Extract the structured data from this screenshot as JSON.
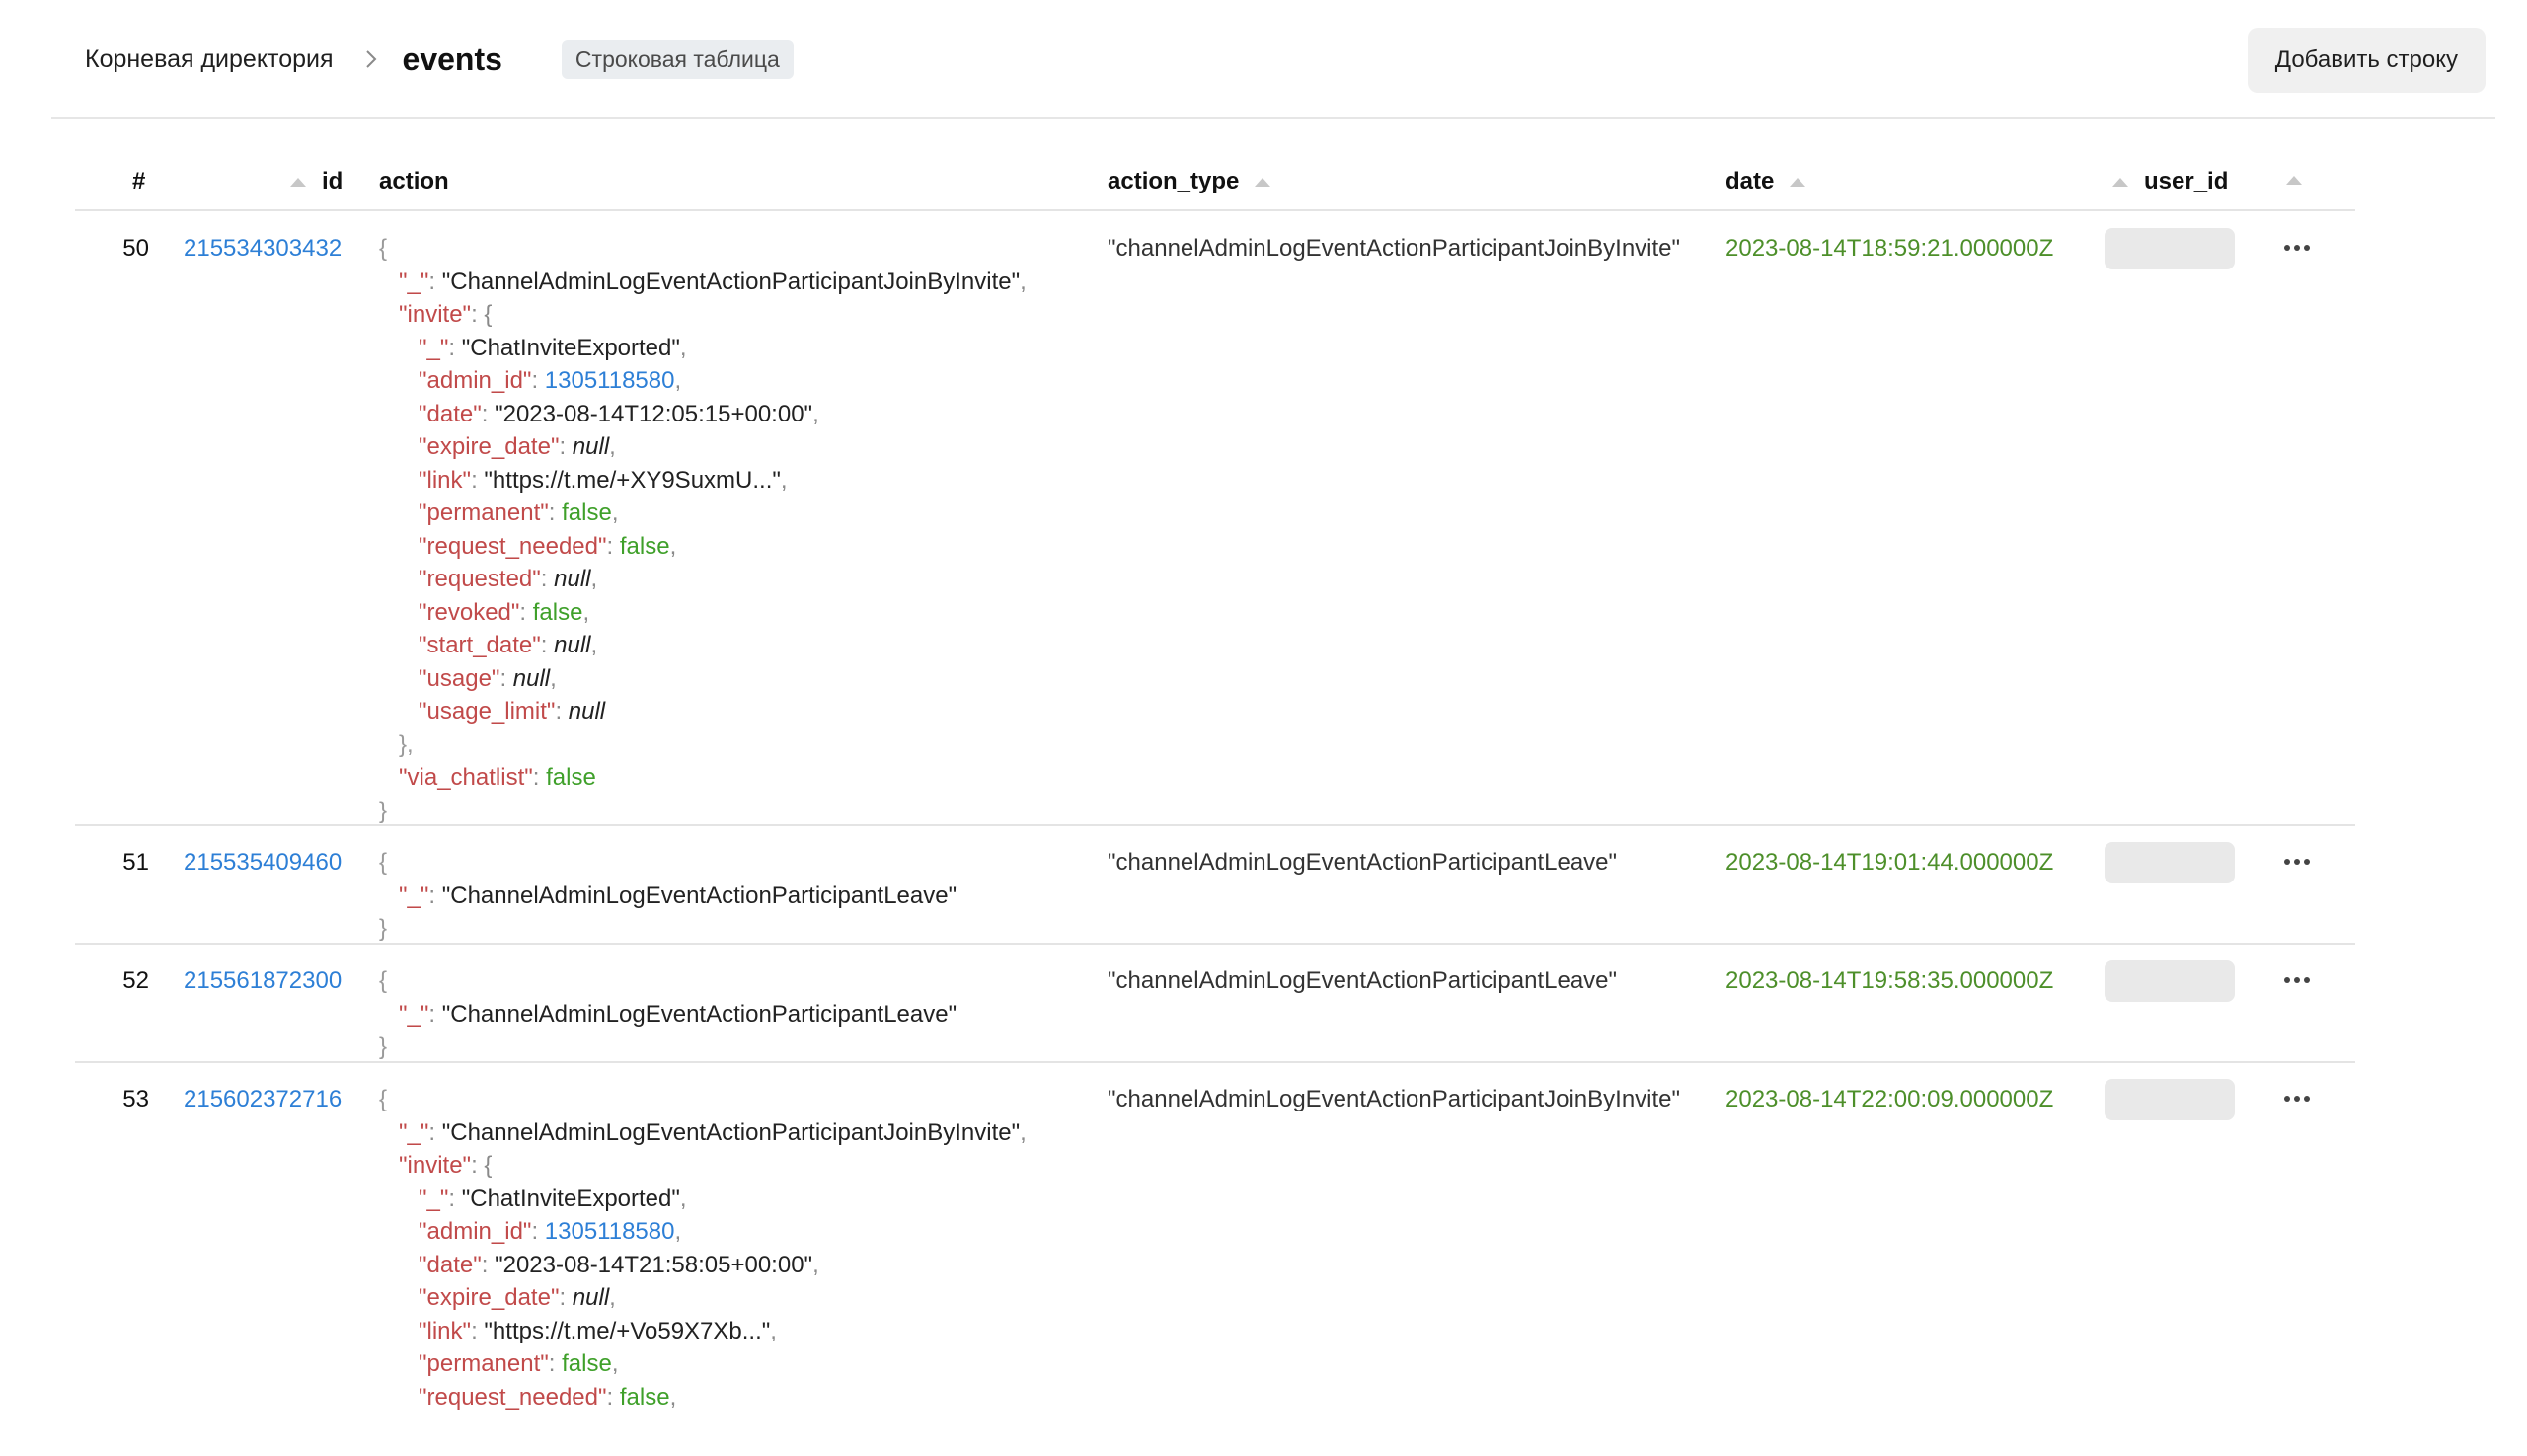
{
  "header": {
    "breadcrumb_root": "Корневая директория",
    "title": "events",
    "table_type": "Строковая таблица",
    "add_row_label": "Добавить строку"
  },
  "columns": [
    "#",
    "id",
    "action",
    "action_type",
    "date",
    "user_id"
  ],
  "colors": {
    "link": "#2d7fd6",
    "json_key": "#c14a4a",
    "bool_value": "#3fa02a",
    "date_value": "#4d8f2a",
    "badge_bg": "#eaedf0"
  },
  "rows": [
    {
      "num": "50",
      "id": "215534303432",
      "action_type": "\"channelAdminLogEventActionParticipantJoinByInvite\"",
      "date": "2023-08-14T18:59:21.000000Z",
      "action": [
        {
          "indent": 0,
          "tokens": [
            {
              "t": "{",
              "c": "brace"
            }
          ]
        },
        {
          "indent": 1,
          "tokens": [
            {
              "t": "\"_\"",
              "c": "key"
            },
            {
              "t": ": ",
              "c": "punc"
            },
            {
              "t": "\"ChannelAdminLogEventActionParticipantJoinByInvite\"",
              "c": "str"
            },
            {
              "t": ",",
              "c": "punc"
            }
          ]
        },
        {
          "indent": 1,
          "tokens": [
            {
              "t": "\"invite\"",
              "c": "key"
            },
            {
              "t": ": {",
              "c": "punc"
            }
          ]
        },
        {
          "indent": 2,
          "tokens": [
            {
              "t": "\"_\"",
              "c": "key"
            },
            {
              "t": ": ",
              "c": "punc"
            },
            {
              "t": "\"ChatInviteExported\"",
              "c": "str"
            },
            {
              "t": ",",
              "c": "punc"
            }
          ]
        },
        {
          "indent": 2,
          "tokens": [
            {
              "t": "\"admin_id\"",
              "c": "key"
            },
            {
              "t": ": ",
              "c": "punc"
            },
            {
              "t": "1305118580",
              "c": "num"
            },
            {
              "t": ",",
              "c": "punc"
            }
          ]
        },
        {
          "indent": 2,
          "tokens": [
            {
              "t": "\"date\"",
              "c": "key"
            },
            {
              "t": ": ",
              "c": "punc"
            },
            {
              "t": "\"2023-08-14T12:05:15+00:00\"",
              "c": "str"
            },
            {
              "t": ",",
              "c": "punc"
            }
          ]
        },
        {
          "indent": 2,
          "tokens": [
            {
              "t": "\"expire_date\"",
              "c": "key"
            },
            {
              "t": ": ",
              "c": "punc"
            },
            {
              "t": "null",
              "c": "null"
            },
            {
              "t": ",",
              "c": "punc"
            }
          ]
        },
        {
          "indent": 2,
          "tokens": [
            {
              "t": "\"link\"",
              "c": "key"
            },
            {
              "t": ": ",
              "c": "punc"
            },
            {
              "t": "\"https://t.me/+XY9SuxmU...\"",
              "c": "str"
            },
            {
              "t": ",",
              "c": "punc"
            }
          ]
        },
        {
          "indent": 2,
          "tokens": [
            {
              "t": "\"permanent\"",
              "c": "key"
            },
            {
              "t": ": ",
              "c": "punc"
            },
            {
              "t": "false",
              "c": "bool"
            },
            {
              "t": ",",
              "c": "punc"
            }
          ]
        },
        {
          "indent": 2,
          "tokens": [
            {
              "t": "\"request_needed\"",
              "c": "key"
            },
            {
              "t": ": ",
              "c": "punc"
            },
            {
              "t": "false",
              "c": "bool"
            },
            {
              "t": ",",
              "c": "punc"
            }
          ]
        },
        {
          "indent": 2,
          "tokens": [
            {
              "t": "\"requested\"",
              "c": "key"
            },
            {
              "t": ": ",
              "c": "punc"
            },
            {
              "t": "null",
              "c": "null"
            },
            {
              "t": ",",
              "c": "punc"
            }
          ]
        },
        {
          "indent": 2,
          "tokens": [
            {
              "t": "\"revoked\"",
              "c": "key"
            },
            {
              "t": ": ",
              "c": "punc"
            },
            {
              "t": "false",
              "c": "bool"
            },
            {
              "t": ",",
              "c": "punc"
            }
          ]
        },
        {
          "indent": 2,
          "tokens": [
            {
              "t": "\"start_date\"",
              "c": "key"
            },
            {
              "t": ": ",
              "c": "punc"
            },
            {
              "t": "null",
              "c": "null"
            },
            {
              "t": ",",
              "c": "punc"
            }
          ]
        },
        {
          "indent": 2,
          "tokens": [
            {
              "t": "\"usage\"",
              "c": "key"
            },
            {
              "t": ": ",
              "c": "punc"
            },
            {
              "t": "null",
              "c": "null"
            },
            {
              "t": ",",
              "c": "punc"
            }
          ]
        },
        {
          "indent": 2,
          "tokens": [
            {
              "t": "\"usage_limit\"",
              "c": "key"
            },
            {
              "t": ": ",
              "c": "punc"
            },
            {
              "t": "null",
              "c": "null"
            }
          ]
        },
        {
          "indent": 1,
          "tokens": [
            {
              "t": "},",
              "c": "brace"
            }
          ]
        },
        {
          "indent": 1,
          "tokens": [
            {
              "t": "\"via_chatlist\"",
              "c": "key"
            },
            {
              "t": ": ",
              "c": "punc"
            },
            {
              "t": "false",
              "c": "bool"
            }
          ]
        },
        {
          "indent": 0,
          "tokens": [
            {
              "t": "}",
              "c": "brace"
            }
          ]
        }
      ]
    },
    {
      "num": "51",
      "id": "215535409460",
      "action_type": "\"channelAdminLogEventActionParticipantLeave\"",
      "date": "2023-08-14T19:01:44.000000Z",
      "action": [
        {
          "indent": 0,
          "tokens": [
            {
              "t": "{",
              "c": "brace"
            }
          ]
        },
        {
          "indent": 1,
          "tokens": [
            {
              "t": "\"_\"",
              "c": "key"
            },
            {
              "t": ": ",
              "c": "punc"
            },
            {
              "t": "\"ChannelAdminLogEventActionParticipantLeave\"",
              "c": "str"
            }
          ]
        },
        {
          "indent": 0,
          "tokens": [
            {
              "t": "}",
              "c": "brace"
            }
          ]
        }
      ]
    },
    {
      "num": "52",
      "id": "215561872300",
      "action_type": "\"channelAdminLogEventActionParticipantLeave\"",
      "date": "2023-08-14T19:58:35.000000Z",
      "action": [
        {
          "indent": 0,
          "tokens": [
            {
              "t": "{",
              "c": "brace"
            }
          ]
        },
        {
          "indent": 1,
          "tokens": [
            {
              "t": "\"_\"",
              "c": "key"
            },
            {
              "t": ": ",
              "c": "punc"
            },
            {
              "t": "\"ChannelAdminLogEventActionParticipantLeave\"",
              "c": "str"
            }
          ]
        },
        {
          "indent": 0,
          "tokens": [
            {
              "t": "}",
              "c": "brace"
            }
          ]
        }
      ]
    },
    {
      "num": "53",
      "id": "215602372716",
      "action_type": "\"channelAdminLogEventActionParticipantJoinByInvite\"",
      "date": "2023-08-14T22:00:09.000000Z",
      "action": [
        {
          "indent": 0,
          "tokens": [
            {
              "t": "{",
              "c": "brace"
            }
          ]
        },
        {
          "indent": 1,
          "tokens": [
            {
              "t": "\"_\"",
              "c": "key"
            },
            {
              "t": ": ",
              "c": "punc"
            },
            {
              "t": "\"ChannelAdminLogEventActionParticipantJoinByInvite\"",
              "c": "str"
            },
            {
              "t": ",",
              "c": "punc"
            }
          ]
        },
        {
          "indent": 1,
          "tokens": [
            {
              "t": "\"invite\"",
              "c": "key"
            },
            {
              "t": ": {",
              "c": "punc"
            }
          ]
        },
        {
          "indent": 2,
          "tokens": [
            {
              "t": "\"_\"",
              "c": "key"
            },
            {
              "t": ": ",
              "c": "punc"
            },
            {
              "t": "\"ChatInviteExported\"",
              "c": "str"
            },
            {
              "t": ",",
              "c": "punc"
            }
          ]
        },
        {
          "indent": 2,
          "tokens": [
            {
              "t": "\"admin_id\"",
              "c": "key"
            },
            {
              "t": ": ",
              "c": "punc"
            },
            {
              "t": "1305118580",
              "c": "num"
            },
            {
              "t": ",",
              "c": "punc"
            }
          ]
        },
        {
          "indent": 2,
          "tokens": [
            {
              "t": "\"date\"",
              "c": "key"
            },
            {
              "t": ": ",
              "c": "punc"
            },
            {
              "t": "\"2023-08-14T21:58:05+00:00\"",
              "c": "str"
            },
            {
              "t": ",",
              "c": "punc"
            }
          ]
        },
        {
          "indent": 2,
          "tokens": [
            {
              "t": "\"expire_date\"",
              "c": "key"
            },
            {
              "t": ": ",
              "c": "punc"
            },
            {
              "t": "null",
              "c": "null"
            },
            {
              "t": ",",
              "c": "punc"
            }
          ]
        },
        {
          "indent": 2,
          "tokens": [
            {
              "t": "\"link\"",
              "c": "key"
            },
            {
              "t": ": ",
              "c": "punc"
            },
            {
              "t": "\"https://t.me/+Vo59X7Xb...\"",
              "c": "str"
            },
            {
              "t": ",",
              "c": "punc"
            }
          ]
        },
        {
          "indent": 2,
          "tokens": [
            {
              "t": "\"permanent\"",
              "c": "key"
            },
            {
              "t": ": ",
              "c": "punc"
            },
            {
              "t": "false",
              "c": "bool"
            },
            {
              "t": ",",
              "c": "punc"
            }
          ]
        },
        {
          "indent": 2,
          "tokens": [
            {
              "t": "\"request_needed\"",
              "c": "key"
            },
            {
              "t": ": ",
              "c": "punc"
            },
            {
              "t": "false",
              "c": "bool"
            },
            {
              "t": ",",
              "c": "punc"
            }
          ]
        }
      ]
    }
  ]
}
